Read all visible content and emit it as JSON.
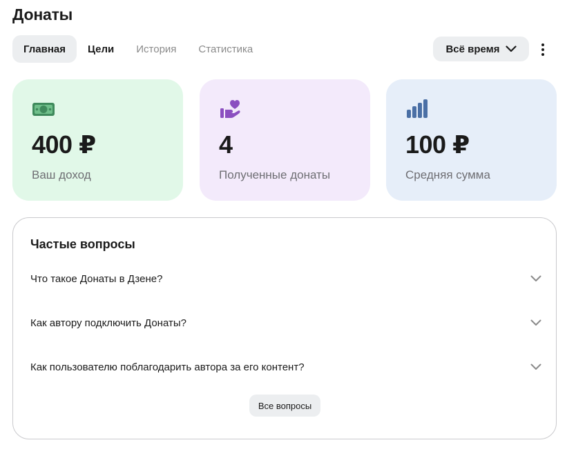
{
  "page": {
    "title": "Донаты"
  },
  "tabs": [
    {
      "label": "Главная",
      "state": "active"
    },
    {
      "label": "Цели",
      "state": "normal"
    },
    {
      "label": "История",
      "state": "muted"
    },
    {
      "label": "Статистика",
      "state": "muted"
    }
  ],
  "period": {
    "label": "Всё время",
    "icon": "chevron-down-icon"
  },
  "more": {
    "icon": "more-vertical-icon"
  },
  "stats": [
    {
      "value": "400 ₽",
      "label": "Ваш доход",
      "icon": "money-icon",
      "bg": "#e1f8e8",
      "icon_color": "#3f8a5c"
    },
    {
      "value": "4",
      "label": "Полученные донаты",
      "icon": "heart-hand-icon",
      "bg": "#f3eafb",
      "icon_color": "#8b4fc0"
    },
    {
      "value": "100 ₽",
      "label": "Средняя сумма",
      "icon": "bar-chart-icon",
      "bg": "#e6eef9",
      "icon_color": "#4a6fa5"
    }
  ],
  "faq": {
    "title": "Частые вопросы",
    "items": [
      {
        "question": "Что такое Донаты в Дзене?"
      },
      {
        "question": "Как автору подключить Донаты?"
      },
      {
        "question": "Как пользователю поблагодарить автора за его контент?"
      }
    ],
    "all_button": "Все вопросы"
  },
  "colors": {
    "text": "#1a1a1a",
    "muted": "#8a8a8a",
    "chip_bg": "#eceef0",
    "border": "#c9c9cc"
  }
}
